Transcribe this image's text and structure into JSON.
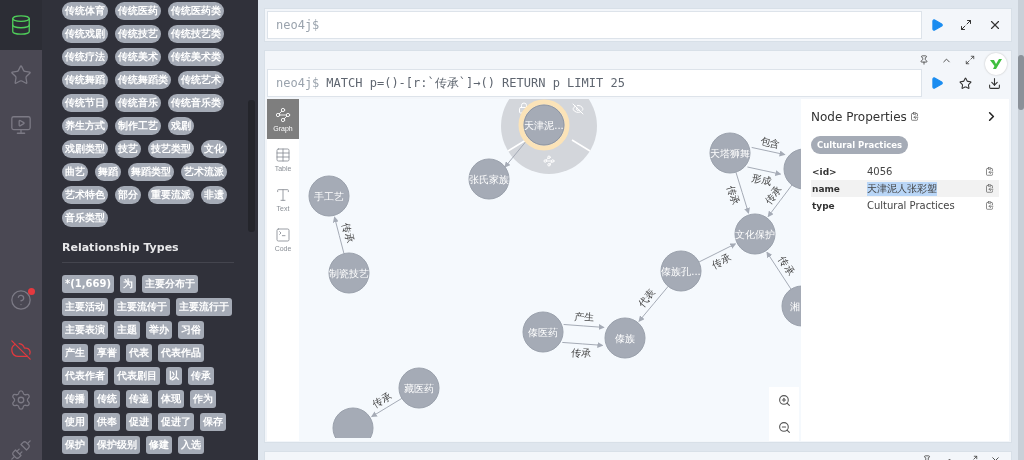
{
  "rail": {
    "items": [
      {
        "kind": "database",
        "selected": true
      },
      {
        "kind": "favorites",
        "selected": false
      },
      {
        "kind": "guides",
        "selected": false
      },
      {
        "kind": "help",
        "selected": false,
        "notification": true
      },
      {
        "kind": "connection",
        "selected": false
      },
      {
        "kind": "settings",
        "selected": false
      },
      {
        "kind": "plugins",
        "selected": false
      }
    ]
  },
  "sidebar": {
    "node_labels": [
      "传统体育",
      "传统医药",
      "传统医药类",
      "传统戏剧",
      "传统技艺",
      "传统技艺类",
      "传统疗法",
      "传统美术",
      "传统美术类",
      "传统舞蹈",
      "传统舞蹈类",
      "传统艺术",
      "传统节日",
      "传统音乐",
      "传统音乐类",
      "养生方式",
      "制作工艺",
      "戏剧",
      "戏剧类型",
      "技艺",
      "技艺类型",
      "文化",
      "曲艺",
      "舞蹈",
      "舞蹈类型",
      "艺术流派",
      "艺术特色",
      "部分",
      "重要流派",
      "非遗",
      "音乐类型"
    ],
    "relationship_heading": "Relationship Types",
    "relationship_types": [
      "*(1,669)",
      "为",
      "主要分布于",
      "主要活动",
      "主要流传于",
      "主要流行于",
      "主要表演",
      "主题",
      "举办",
      "习俗",
      "产生",
      "享誉",
      "代表",
      "代表作品",
      "代表作者",
      "代表剧目",
      "以",
      "传承",
      "传播",
      "传统",
      "传递",
      "体现",
      "作为",
      "使用",
      "供奉",
      "促进",
      "促进了",
      "保存",
      "保护",
      "保护级别",
      "修建",
      "入选"
    ]
  },
  "editor": {
    "prompt": "neo4j$"
  },
  "result_frame": {
    "prompt": "neo4j$",
    "query": "MATCH p=()-[r:`传承`]→() RETURN p LIMIT 25",
    "view_tabs": [
      {
        "label": "Graph",
        "kind": "graph",
        "selected": true
      },
      {
        "label": "Table",
        "kind": "table",
        "selected": false
      },
      {
        "label": "Text",
        "kind": "text",
        "selected": false
      },
      {
        "label": "Code",
        "kind": "code",
        "selected": false
      }
    ],
    "graph": {
      "nodes": [
        {
          "label": "天津泥...",
          "selected": true
        },
        {
          "label": "张氏家族",
          "selected": false
        },
        {
          "label": "手工艺",
          "selected": false
        },
        {
          "label": "制瓷技艺",
          "selected": false
        },
        {
          "label": "天塔狮舞",
          "selected": false
        },
        {
          "selected": false
        },
        {
          "label": "文化保护",
          "selected": false
        },
        {
          "label": "傣族孔...",
          "selected": false
        },
        {
          "label": "湘",
          "selected": false
        },
        {
          "label": "傣医药",
          "selected": false
        },
        {
          "label": "傣族",
          "selected": false
        },
        {
          "label": "藏医药",
          "selected": false
        },
        {
          "selected": false
        }
      ],
      "relationships": [
        {
          "label": "传承"
        },
        {
          "label": "包含"
        },
        {
          "label": "形成"
        },
        {
          "label": "传承"
        },
        {
          "label": "传承"
        },
        {
          "label": "传承"
        },
        {
          "label": "传承"
        },
        {
          "label": "代表"
        },
        {
          "label": "产生"
        },
        {
          "label": "传承"
        },
        {
          "label": "传承"
        }
      ]
    },
    "properties": {
      "title": "Node Properties",
      "label_chip": "Cultural Practices",
      "rows": [
        {
          "key": "<id>",
          "value": "4056",
          "highlighted": false
        },
        {
          "key": "name",
          "value": "天津泥人张彩塑",
          "highlighted": true
        },
        {
          "key": "type",
          "value": "Cultural Practices",
          "highlighted": false
        }
      ]
    }
  }
}
